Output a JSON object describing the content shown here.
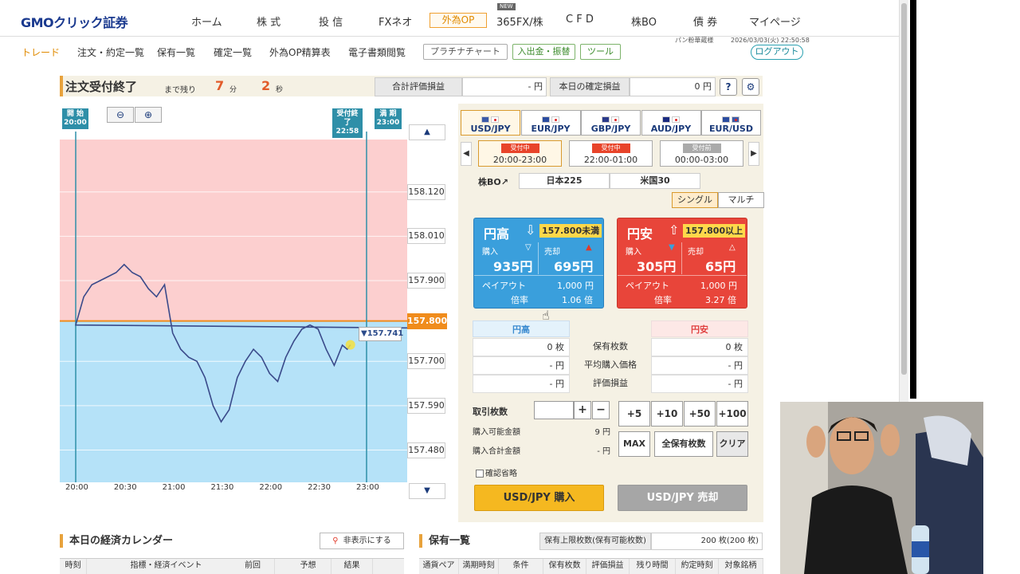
{
  "nav": {
    "logo": "GMOクリック証券",
    "items": [
      "ホーム",
      "株 式",
      "投 信",
      "FXネオ",
      "外為OP",
      "365FX/株",
      "C F D",
      "株BO",
      "債 券",
      "マイページ"
    ],
    "new_tag": "NEW"
  },
  "subnav": {
    "items": [
      "トレード",
      "注文・約定一覧",
      "保有一覧",
      "確定一覧",
      "外為OP精算表",
      "電子書類閲覧"
    ],
    "buttons": [
      "プラチナチャート",
      "入出金・振替",
      "ツール"
    ],
    "user": "パン粉華蔵様",
    "datetime": "2026/03/03(火) 22:50:58",
    "logout": "ログアウト"
  },
  "tradebar": {
    "status": "注文受付終了",
    "remain_label": "まで残り",
    "minutes": "7",
    "min_unit": "分",
    "seconds": "2",
    "sec_unit": "秒",
    "eval_label": "合計評価損益",
    "eval_value": "- 円",
    "settled_label": "本日の確定損益",
    "settled_value": "0 円",
    "help": "?",
    "settings": "gear-icon"
  },
  "chart": {
    "start_label": "開 始",
    "start_time": "20:00",
    "close_label": "受付終了",
    "close_time": "22:58",
    "expiry_label": "満 期",
    "expiry_time": "23:00",
    "zoom_out": "zoom-out-icon",
    "zoom_in": "zoom-in-icon",
    "current_price": "157.741",
    "colors": {
      "upper": "#fccfcf",
      "lower": "#b5e2f8",
      "line": "#3a4a8a",
      "strike": "#f08c1c",
      "marker": "#2e8fa8"
    }
  },
  "chart_data": {
    "type": "line",
    "ylim": [
      157.4,
      158.25
    ],
    "xlim": [
      "20:00",
      "23:00"
    ],
    "xticks": [
      "20:00",
      "20:30",
      "21:00",
      "21:30",
      "22:00",
      "22:30",
      "23:00"
    ],
    "yticks": [
      "158.120",
      "158.010",
      "157.900",
      "157.800",
      "157.700",
      "157.590",
      "157.480"
    ],
    "strike": "157.800",
    "x": [
      "19:57",
      "20:00",
      "20:05",
      "20:10",
      "20:15",
      "20:20",
      "20:25",
      "20:30",
      "20:35",
      "20:40",
      "20:45",
      "20:50",
      "20:55",
      "21:00",
      "21:05",
      "21:10",
      "21:15",
      "21:20",
      "21:25",
      "21:30",
      "21:35",
      "21:40",
      "21:45",
      "21:50",
      "21:55",
      "22:00",
      "22:05",
      "22:10",
      "22:15",
      "22:20",
      "22:25",
      "22:30",
      "22:35",
      "22:40",
      "22:45",
      "22:48",
      "22:50"
    ],
    "y": [
      157.74,
      157.79,
      157.86,
      157.89,
      157.9,
      157.91,
      157.92,
      157.94,
      157.92,
      157.91,
      157.88,
      157.86,
      157.89,
      157.77,
      157.73,
      157.71,
      157.7,
      157.66,
      157.59,
      157.55,
      157.58,
      157.66,
      157.7,
      157.73,
      157.71,
      157.67,
      157.65,
      157.71,
      157.75,
      157.78,
      157.79,
      157.78,
      157.73,
      157.69,
      157.74,
      157.73,
      157.741
    ]
  },
  "panel": {
    "pairs": [
      {
        "label": "USD/JPY",
        "selected": true
      },
      {
        "label": "EUR/JPY",
        "selected": false
      },
      {
        "label": "GBP/JPY",
        "selected": false
      },
      {
        "label": "AUD/JPY",
        "selected": false
      },
      {
        "label": "EUR/USD",
        "selected": false
      }
    ],
    "slots": [
      {
        "badge": "受付中",
        "time": "20:00-23:00"
      },
      {
        "badge": "受付中",
        "time": "22:00-01:00"
      },
      {
        "badge": "受付前",
        "time": "00:00-03:00"
      }
    ],
    "kabubo": "株BO↗",
    "indices": [
      "日本225",
      "米国30"
    ],
    "modes": [
      "シングル",
      "マルチ"
    ]
  },
  "cards": {
    "high": {
      "title": "円高",
      "cond": "157.800未満",
      "buy_label": "購入",
      "buy_price": "935円",
      "sell_label": "売却",
      "sell_price": "695円",
      "payout_label": "ペイアウト",
      "payout": "1,000 円",
      "rate_label": "倍率",
      "rate": "1.06 倍"
    },
    "low": {
      "title": "円安",
      "cond": "157.800以上",
      "buy_label": "購入",
      "buy_price": "305円",
      "sell_label": "売却",
      "sell_price": "65円",
      "payout_label": "ペイアウト",
      "payout": "1,000 円",
      "rate_label": "倍率",
      "rate": "3.27 倍"
    }
  },
  "positions": {
    "high_header": "円高",
    "low_header": "円安",
    "rows": [
      {
        "label": "保有枚数",
        "high": "0 枚",
        "low": "0 枚"
      },
      {
        "label": "平均購入価格",
        "high": "- 円",
        "low": "- 円"
      },
      {
        "label": "評価損益",
        "high": "- 円",
        "low": "- 円"
      }
    ]
  },
  "order": {
    "qty_label": "取引枚数",
    "plus": "+",
    "minus": "−",
    "increments": [
      "+5",
      "+10",
      "+50",
      "+100"
    ],
    "avail_label": "購入可能金額",
    "avail_value": "9 円",
    "total_label": "購入合計金額",
    "total_value": "- 円",
    "max": "MAX",
    "all": "全保有枚数",
    "clear": "クリア",
    "skip_confirm": "確認省略",
    "buy": "USD/JPY 購入",
    "sell": "USD/JPY 売却"
  },
  "bottom": {
    "calendar_title": "本日の経済カレンダー",
    "hide": "非表示にする",
    "calendar_cols": [
      "時刻",
      "指標・経済イベント",
      "前回",
      "予想",
      "結果"
    ],
    "holdings_title": "保有一覧",
    "limit_label": "保有上限枚数(保有可能枚数)",
    "limit_value": "200 枚(200 枚)",
    "holdings_cols": [
      "通貨ペア",
      "満期時刻",
      "条件",
      "保有枚数",
      "評価損益",
      "残り時間",
      "約定時刻",
      "対象銘柄"
    ]
  }
}
